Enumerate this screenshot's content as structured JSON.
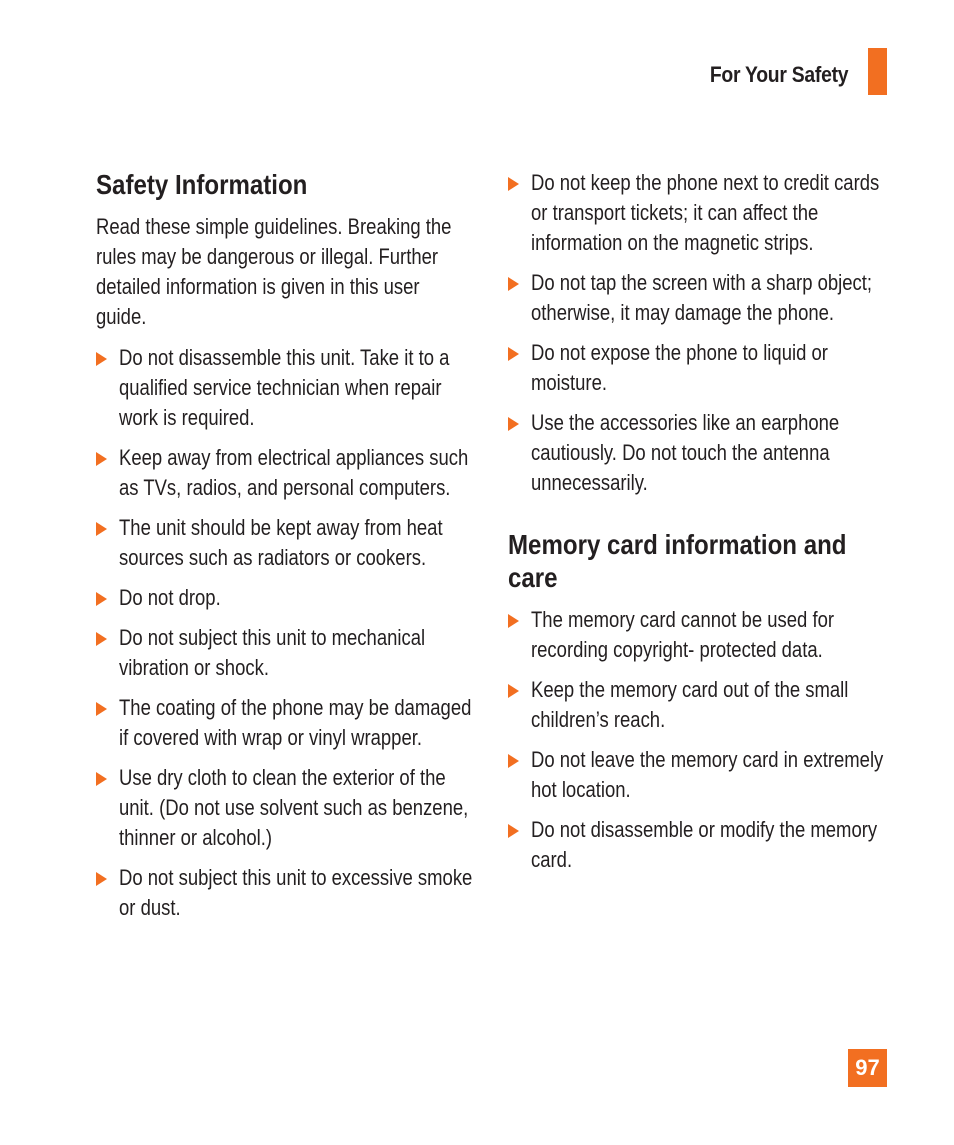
{
  "header": {
    "section_label": "For Your Safety",
    "accent_color": "#f26f21"
  },
  "left": {
    "title": "Safety Information",
    "intro": "Read these simple guidelines. Breaking the rules may be dangerous or illegal. Further detailed information is given in this user guide.",
    "bullets": [
      "Do not disassemble this unit. Take it to a qualified service technician when repair work is required.",
      "Keep away from electrical appliances such as TVs, radios, and personal computers.",
      "The unit should be kept away from heat sources such as radiators or cookers.",
      "Do not drop.",
      "Do not subject this unit to mechanical vibration or shock.",
      "The coating of the phone may be damaged if covered with wrap or vinyl wrapper.",
      "Use dry cloth to clean the exterior of the unit. (Do not use solvent such as benzene, thinner or alcohol.)",
      "Do not subject this unit to excessive smoke or dust."
    ]
  },
  "right": {
    "bullets_top": [
      "Do not keep the phone next to credit cards or transport tickets; it can affect the information on the magnetic strips.",
      "Do not tap the screen with a sharp object; otherwise, it may damage the phone.",
      "Do not expose the phone to liquid or moisture.",
      "Use the accessories like an earphone cautiously. Do not touch the antenna unnecessarily."
    ],
    "memory_title_line1": "Memory card information and",
    "memory_title_line2": "care",
    "memory_bullets": [
      "The memory card cannot be used for recording copyright- protected data.",
      "Keep the memory card out of the small children’s reach.",
      "Do not leave the memory card in extremely hot location.",
      "Do not disassemble or modify the memory card."
    ]
  },
  "footer": {
    "page_number": "97"
  }
}
